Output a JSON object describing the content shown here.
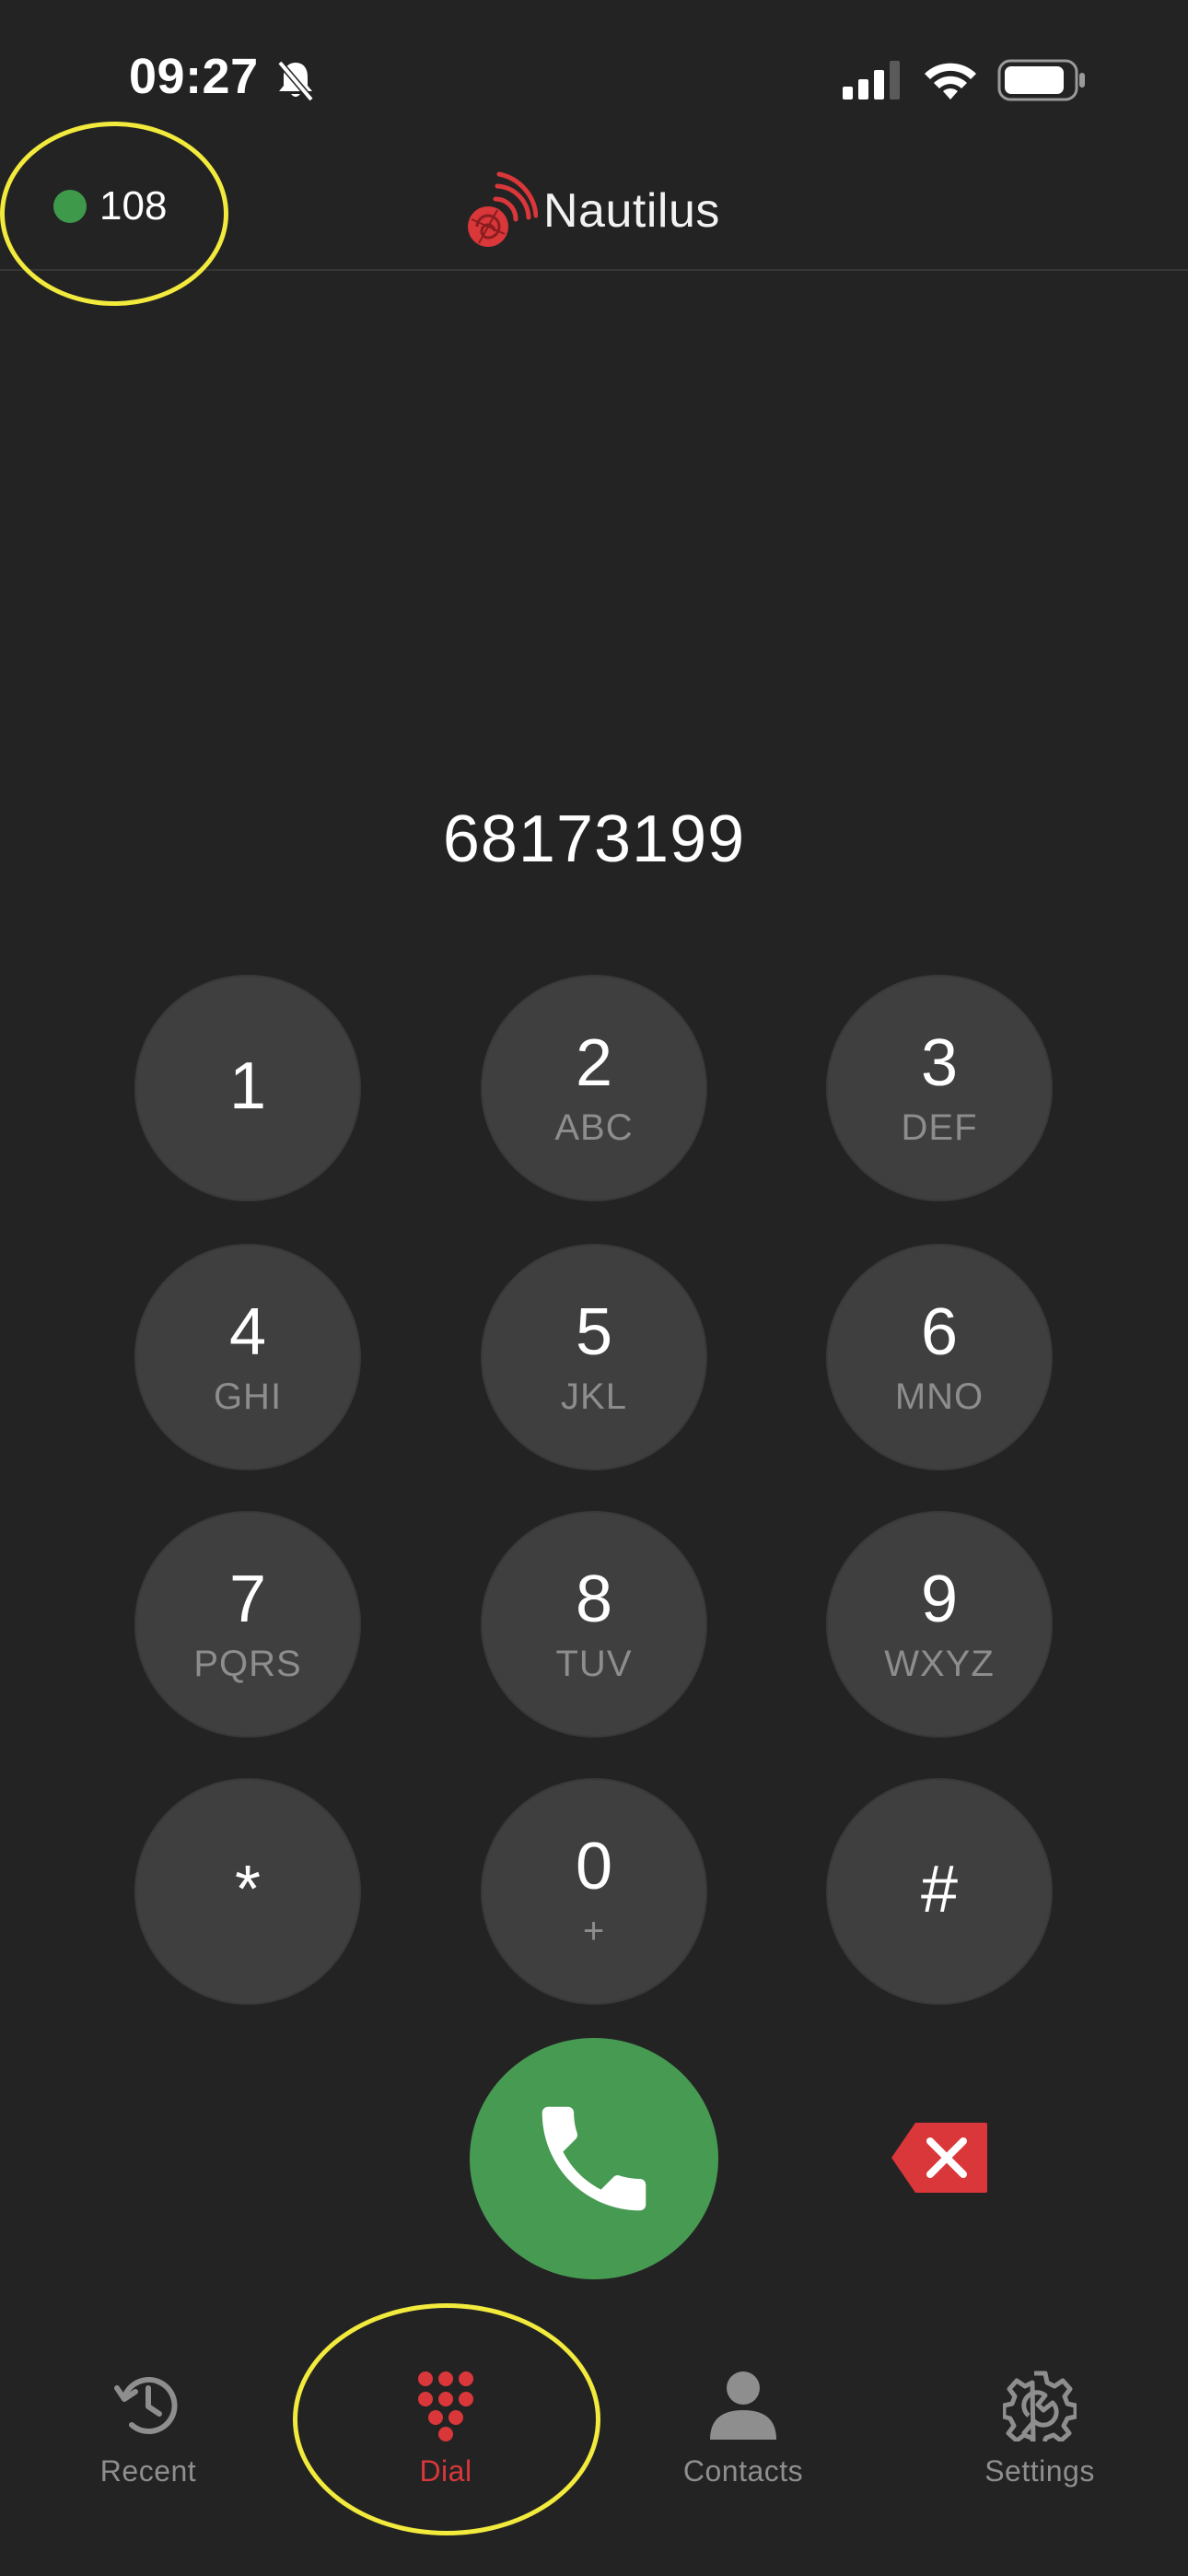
{
  "status_bar": {
    "time": "09:27",
    "icons": [
      "bell-slash-icon",
      "cellular-signal-icon",
      "wifi-icon",
      "battery-icon"
    ]
  },
  "header": {
    "extension": "108",
    "registration_status_color": "#3e9a4a",
    "brand_name": "Nautilus",
    "brand_color": "#d9373a"
  },
  "dialer": {
    "number": "68173199",
    "keys": [
      {
        "digit": "1",
        "letters": ""
      },
      {
        "digit": "2",
        "letters": "ABC"
      },
      {
        "digit": "3",
        "letters": "DEF"
      },
      {
        "digit": "4",
        "letters": "GHI"
      },
      {
        "digit": "5",
        "letters": "JKL"
      },
      {
        "digit": "6",
        "letters": "MNO"
      },
      {
        "digit": "7",
        "letters": "PQRS"
      },
      {
        "digit": "8",
        "letters": "TUV"
      },
      {
        "digit": "9",
        "letters": "WXYZ"
      },
      {
        "digit": "*",
        "letters": ""
      },
      {
        "digit": "0",
        "letters": "+"
      },
      {
        "digit": "#",
        "letters": ""
      }
    ],
    "call_color": "#479a52",
    "delete_color": "#d9373a"
  },
  "tabs": [
    {
      "label": "Recent",
      "icon": "history-icon",
      "active": false
    },
    {
      "label": "Dial",
      "icon": "keypad-icon",
      "active": true
    },
    {
      "label": "Contacts",
      "icon": "person-icon",
      "active": false
    },
    {
      "label": "Settings",
      "icon": "gear-wrench-icon",
      "active": false
    }
  ],
  "annotation_color": "#f2ea3c"
}
